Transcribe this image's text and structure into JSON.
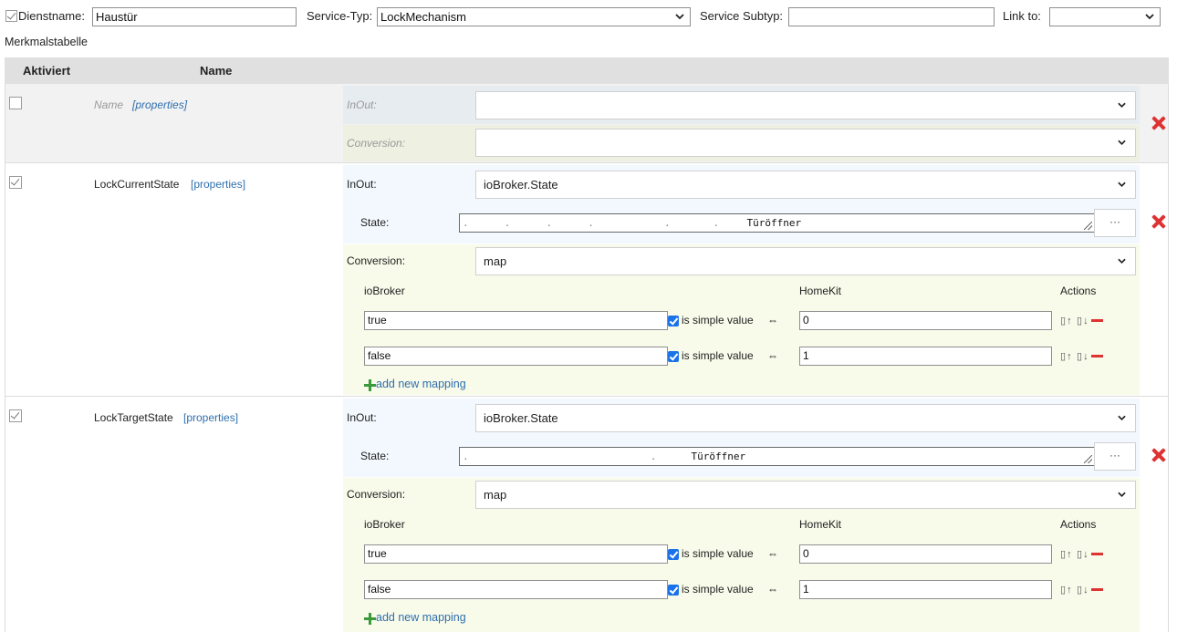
{
  "header": {
    "service_name_label": "Dienstname:",
    "service_name_value": "Haustür",
    "service_type_label": "Service-Typ:",
    "service_type_value": "LockMechanism",
    "service_subtype_label": "Service Subtyp:",
    "service_subtype_value": "",
    "link_to_label": "Link to:",
    "link_to_value": ""
  },
  "table_title": "Merkmalstabelle",
  "columns": {
    "enabled": "Aktiviert",
    "name": "Name"
  },
  "rows": [
    {
      "name": "Name",
      "properties_link": "[properties]",
      "inout_label": "InOut:",
      "inout_value": "",
      "conversion_label": "Conversion:",
      "conversion_value": ""
    },
    {
      "name": "LockCurrentState",
      "properties_link": "[properties]",
      "inout_label": "InOut:",
      "inout_value": "ioBroker.State",
      "state_label": "State:",
      "state_value": "Türöffner",
      "state_button": "···",
      "conversion_label": "Conversion:",
      "conversion_value": "map",
      "mapping": {
        "col_iobroker": "ioBroker",
        "col_homekit": "HomeKit",
        "col_actions": "Actions",
        "simple_label": "is simple value",
        "swap_symbol": "⇔",
        "items": [
          {
            "iobroker": "true",
            "homekit": "0"
          },
          {
            "iobroker": "false",
            "homekit": "1"
          }
        ],
        "add_label": "add new mapping"
      }
    },
    {
      "name": "LockTargetState",
      "properties_link": "[properties]",
      "inout_label": "InOut:",
      "inout_value": "ioBroker.State",
      "state_label": "State:",
      "state_value": "Türöffner",
      "state_button": "···",
      "conversion_label": "Conversion:",
      "conversion_value": "map",
      "mapping": {
        "col_iobroker": "ioBroker",
        "col_homekit": "HomeKit",
        "col_actions": "Actions",
        "simple_label": "is simple value",
        "swap_symbol": "⇔",
        "items": [
          {
            "iobroker": "true",
            "homekit": "0"
          },
          {
            "iobroker": "false",
            "homekit": "1"
          }
        ],
        "add_label": "add new mapping"
      }
    }
  ],
  "icons": {
    "move_up": "↑",
    "move_down": "↓",
    "delete": "delete-icon",
    "add": "plus-icon"
  },
  "colors": {
    "header_bg": "#e0e0e0",
    "disabled_row_bg": "#f2f2f2",
    "inout_bg": "#f2f8fd",
    "conversion_bg": "#f8faea",
    "delete_red": "#dd3333",
    "add_green": "#3a9a3a",
    "link_blue": "#2f6fad"
  }
}
